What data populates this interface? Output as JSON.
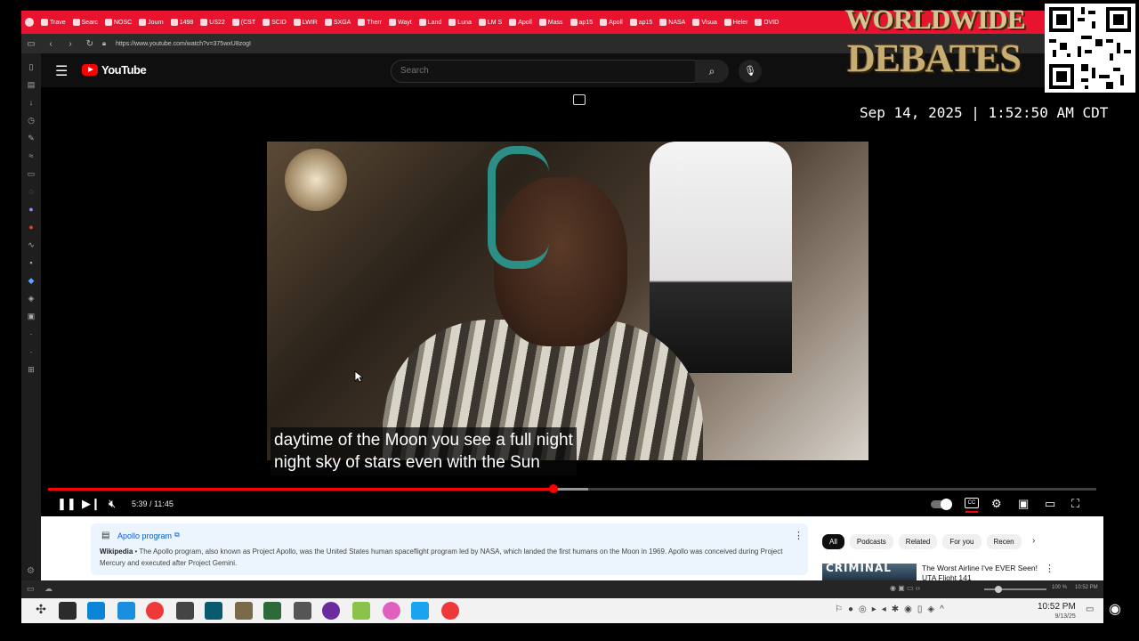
{
  "browser": {
    "tabs": [
      "Trave",
      "Searc",
      "NOSC",
      "Journ",
      "1498",
      "US22",
      "(CST",
      "SCID",
      "LWIR",
      "SXGA",
      "Therr",
      "Wayt",
      "Land",
      "Luna",
      "LM S",
      "Apoll",
      "Mass",
      "ap15",
      "Apoll",
      "ap15",
      "NASA",
      "Visua",
      "Heler",
      "DVID"
    ],
    "url": "https://www.youtube.com/watch?v=375wxU8zogI"
  },
  "youtube": {
    "logo_text": "YouTube",
    "search_placeholder": "Search"
  },
  "overlay": {
    "brand_line1": "WORLDWIDE",
    "brand_line2": "DEBATES",
    "datetime": "Sep 14, 2025 | 1:52:50 AM CDT"
  },
  "player": {
    "caption_line1": "daytime of the Moon you see a full night",
    "caption_line2": "night sky of stars even with the Sun",
    "time_display": "5:39 / 11:45",
    "progress_fraction": 0.482,
    "buffer_fraction": 0.515,
    "autoplay_on": true
  },
  "info_panel": {
    "title": "Apollo program",
    "source_label": "Wikipedia",
    "separator": " • ",
    "text": "The Apollo program, also known as Project Apollo, was the United States human spaceflight program led by NASA, which landed the first humans on the Moon in 1969. Apollo was conceived during Project Mercury and executed after Project Gemini."
  },
  "chips": [
    "All",
    "Podcasts",
    "Related",
    "For you",
    "Recen"
  ],
  "recommendation": {
    "thumb_text": "CRIMINAL",
    "title": "The Worst Airline I've EVER Seen! UTA Flight 141"
  },
  "status_zoom": "100 %",
  "status_time": "10:52 PM",
  "taskbar": {
    "time": "10:52 PM",
    "date": "9/13/25"
  },
  "colors": {
    "tabstrip": "#e8132e",
    "yt_red": "#ff0000",
    "progress": "#ff0000",
    "wiki_bg": "#ecf4fd",
    "link_blue": "#065fd4"
  }
}
